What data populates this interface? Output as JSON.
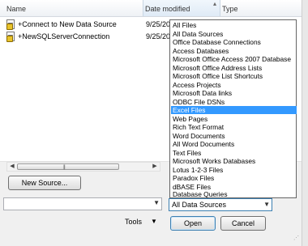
{
  "columns": {
    "name": "Name",
    "date_modified": "Date modified",
    "type": "Type"
  },
  "files": [
    {
      "name": "+Connect to New Data Source",
      "date": "9/25/20",
      "icon": "data-source-file-icon"
    },
    {
      "name": "+NewSQLServerConnection",
      "date": "9/25/20",
      "icon": "data-source-file-icon"
    }
  ],
  "new_source_button": "New Source...",
  "filter": {
    "selected": "All Data Sources",
    "options": [
      "All Files",
      "All Data Sources",
      "Office Database Connections",
      "Access Databases",
      "Microsoft Office Access 2007 Database",
      "Microsoft Office Address Lists",
      "Microsoft Office List Shortcuts",
      "Access Projects",
      "Microsoft Data links",
      "ODBC File DSNs",
      "Excel Files",
      "Web Pages",
      "Rich Text Format",
      "Word Documents",
      "All Word Documents",
      "Text Files",
      "Microsoft Works Databases",
      "Lotus 1-2-3 Files",
      "Paradox Files",
      "dBASE Files",
      "Database Queries"
    ],
    "highlighted": "Excel Files"
  },
  "tools_label": "Tools",
  "open_button": "Open",
  "cancel_button": "Cancel",
  "colors": {
    "highlight": "#3399ff",
    "focus_border": "#3c7fb1"
  }
}
